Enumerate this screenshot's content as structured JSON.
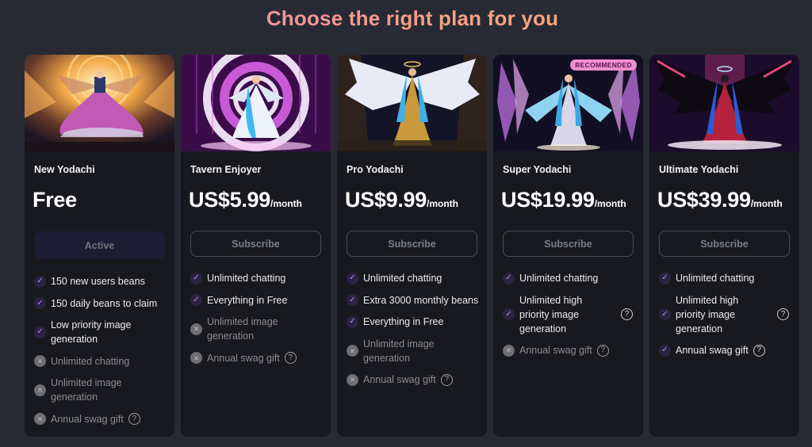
{
  "page": {
    "title": "Choose the right plan for you"
  },
  "plans": [
    {
      "name": "New Yodachi",
      "price": "Free",
      "period": "",
      "button": "Active",
      "badge": "",
      "art": "golden-angel-artwork",
      "features": [
        {
          "text": "150 new users beans",
          "included": true,
          "help": false
        },
        {
          "text": "150 daily beans to claim",
          "included": true,
          "help": false
        },
        {
          "text": "Low priority image generation",
          "included": true,
          "help": false
        },
        {
          "text": "Unlimited chatting",
          "included": false,
          "help": false
        },
        {
          "text": "Unlimited image generation",
          "included": false,
          "help": false
        },
        {
          "text": "Annual swag gift",
          "included": false,
          "help": true
        }
      ]
    },
    {
      "name": "Tavern Enjoyer",
      "price": "US$5.99",
      "period": "/month",
      "button": "Subscribe",
      "badge": "",
      "art": "neon-circle-angel-artwork",
      "features": [
        {
          "text": "Unlimited chatting",
          "included": true,
          "help": false
        },
        {
          "text": "Everything in Free",
          "included": true,
          "help": false
        },
        {
          "text": "Unlimited image generation",
          "included": false,
          "help": false
        },
        {
          "text": "Annual swag gift",
          "included": false,
          "help": true
        }
      ]
    },
    {
      "name": "Pro Yodachi",
      "price": "US$9.99",
      "period": "/month",
      "button": "Subscribe",
      "badge": "",
      "art": "white-winged-angel-artwork",
      "features": [
        {
          "text": "Unlimited chatting",
          "included": true,
          "help": false
        },
        {
          "text": "Extra 3000 monthly beans",
          "included": true,
          "help": false
        },
        {
          "text": "Everything in Free",
          "included": true,
          "help": false
        },
        {
          "text": "Unlimited image generation",
          "included": false,
          "help": false
        },
        {
          "text": "Annual swag gift",
          "included": false,
          "help": true
        }
      ]
    },
    {
      "name": "Super Yodachi",
      "price": "US$19.99",
      "period": "/month",
      "button": "Subscribe",
      "badge": "RECOMMENDED",
      "art": "crystal-angel-artwork",
      "features": [
        {
          "text": "Unlimited chatting",
          "included": true,
          "help": false
        },
        {
          "text": "Unlimited high priority image generation",
          "included": true,
          "help": true
        },
        {
          "text": "Annual swag gift",
          "included": false,
          "help": true
        }
      ]
    },
    {
      "name": "Ultimate Yodachi",
      "price": "US$39.99",
      "period": "/month",
      "button": "Subscribe",
      "badge": "",
      "art": "dark-winged-angel-artwork",
      "features": [
        {
          "text": "Unlimited chatting",
          "included": true,
          "help": false
        },
        {
          "text": "Unlimited high priority image generation",
          "included": true,
          "help": true
        },
        {
          "text": "Annual swag gift",
          "included": true,
          "help": true
        }
      ]
    }
  ],
  "icons": {
    "check": "✓",
    "cross": "✕",
    "help": "?"
  },
  "colors": {
    "title_gradient_start": "#f27fb3",
    "title_gradient_end": "#f7b26c",
    "background": "#272a33",
    "card": "#18191e",
    "check_bg": "#2a2342",
    "check_fg": "#c285e6",
    "badge": "#f08fd0"
  }
}
